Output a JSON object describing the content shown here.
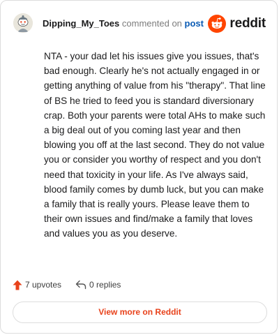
{
  "header": {
    "author": "Dipping_My_Toes",
    "action_text": "commented on",
    "post_link_label": "post",
    "brand_name": "reddit"
  },
  "comment": {
    "body": "NTA - your dad let his issues give you issues, that's bad enough. Clearly he's not actually engaged in or getting anything of value from his \"therapy\". That line of BS he tried to feed you is standard diversionary crap. Both your parents were total AHs to make such a big deal out of you coming last year and then blowing you off at the last second. They do not value you or consider you worthy of respect and you don't need that toxicity in your life. As I've always said, blood family comes by dumb luck, but you can make a family that is really yours. Please leave them to their own issues and find/make a family that loves and values you as you deserve."
  },
  "footer": {
    "upvotes": "7 upvotes",
    "replies": "0 replies"
  },
  "cta": {
    "view_more_label": "View more on Reddit"
  },
  "icons": {
    "avatar": "snoo-avatar",
    "brand": "reddit-logo-icon",
    "upvote": "upvote-arrow-icon",
    "reply": "reply-arrow-icon"
  },
  "colors": {
    "brand_orange": "#ff4500",
    "link_blue": "#0a5bb4",
    "cta_text": "#e8421b",
    "upvote_arrow": "#e8421b",
    "muted_text": "#7c7c7c"
  }
}
